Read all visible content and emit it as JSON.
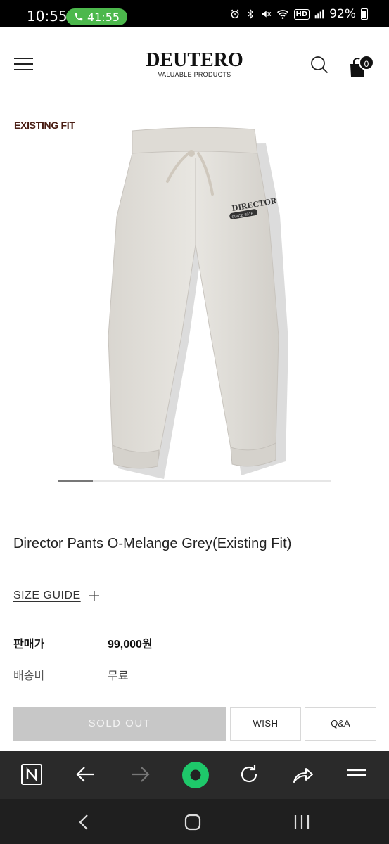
{
  "status_bar": {
    "time": "10:55",
    "call_timer": "41:55",
    "battery": "92%",
    "icons": [
      "alarm-icon",
      "bluetooth-icon",
      "mute-icon",
      "wifi-icon",
      "hd-icon",
      "signal-icon",
      "battery-icon"
    ],
    "hd_label": "HD"
  },
  "header": {
    "brand": "DEUTERO",
    "tagline": "VALUABLE PRODUCTS",
    "cart_count": "0"
  },
  "product": {
    "fit_label": "EXISTING FIT",
    "image_text": "DIRECTOR",
    "image_badge": "SINCE 2016",
    "title": "Director Pants O-Melange Grey(Existing Fit)",
    "size_guide": "SIZE GUIDE",
    "size_guide_icon": "plus-icon",
    "price_label": "판매가",
    "price_value": "99,000원",
    "shipping_label": "배송비",
    "shipping_value": "무료",
    "image_slider": {
      "current": 1,
      "total": 8
    }
  },
  "actions": {
    "sold_out": "SOLD OUT",
    "wish": "WISH",
    "qa": "Q&A"
  },
  "browser_bar": {
    "items": [
      "naver-home-icon",
      "back-icon",
      "forward-icon",
      "green-dot-icon",
      "reload-icon",
      "share-icon",
      "menu-icon"
    ]
  },
  "system_nav": {
    "items": [
      "system-back-icon",
      "system-home-icon",
      "system-recents-icon"
    ]
  },
  "colors": {
    "accent_fit_label": "#4a1e14",
    "sold_out_bg": "#c7c7c7",
    "call_pill": "#4cb84c",
    "browser_green": "#1ec86a"
  }
}
